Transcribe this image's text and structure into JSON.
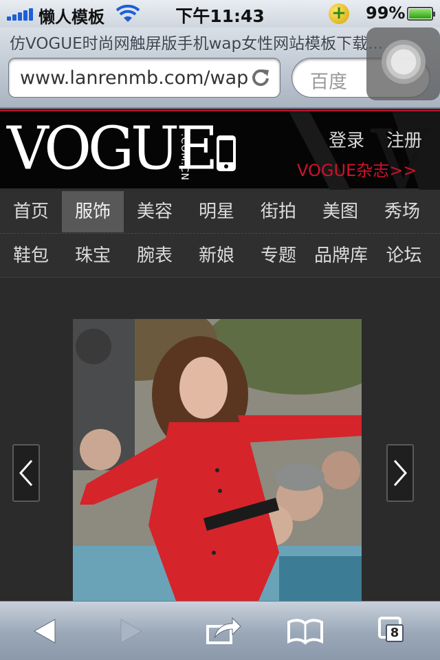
{
  "status_bar": {
    "carrier": "懒人模板",
    "time": "下午11:43",
    "battery": "99%",
    "battery_level": 0.99
  },
  "browser": {
    "page_title": "仿VOGUE时尚网触屏版手机wap女性网站模板下载...",
    "url": "www.lanrenmb.com/wap",
    "search_placeholder": "百度",
    "tabs_count": "8"
  },
  "header": {
    "logo": "VOGUE",
    "logo_sub": ".COM.CN",
    "login": "登录",
    "register": "注册",
    "magazine": "VOGUE杂志>>"
  },
  "nav": {
    "row1": [
      "首页",
      "服饰",
      "美容",
      "明星",
      "街拍",
      "美图",
      "秀场"
    ],
    "row2": [
      "鞋包",
      "珠宝",
      "腕表",
      "新娘",
      "专题",
      "品牌库",
      "论坛"
    ],
    "active": "服饰"
  },
  "colors": {
    "accent_red": "#d2102b",
    "header_bg": "#050505",
    "nav_bg": "#2f2f2f",
    "active_tab_bg": "#585858"
  },
  "icons": {
    "reload": "reload-icon",
    "phone": "mobile-phone-icon",
    "prev": "chevron-left-icon",
    "next": "chevron-right-icon",
    "back": "back-arrow-icon",
    "forward": "forward-arrow-icon",
    "share": "share-icon",
    "bookmarks": "bookmarks-icon",
    "tabs": "tabs-icon"
  }
}
